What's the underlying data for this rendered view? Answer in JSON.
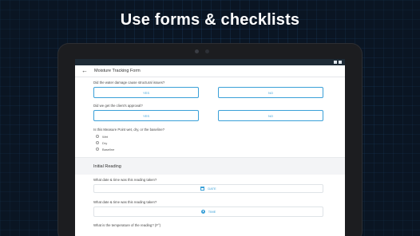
{
  "headline": "Use forms & checklists",
  "app": {
    "title": "Moisture Tracking Form"
  },
  "form": {
    "q1": {
      "text": "Did the water damage cause structural issues?",
      "yes": "YES",
      "no": "NO"
    },
    "q2": {
      "text": "Did we get the client's approval?",
      "yes": "YES",
      "no": "NO"
    },
    "q3": {
      "text": "Is this Measure Point wet, dry, or the baseline?",
      "options": [
        "Wet",
        "Dry",
        "Baseline"
      ]
    },
    "section_title": "Initial Reading",
    "q4": {
      "text": "What date & time was this reading taken?",
      "button": "DATE"
    },
    "q5": {
      "text": "What date & time was this reading taken?",
      "button": "TIME"
    },
    "q6": {
      "text": "What is the temperature of the reading? (F°)"
    }
  },
  "icons": {
    "back": "arrow-back-icon",
    "date": "calendar-icon",
    "time": "clock-icon"
  },
  "colors": {
    "accent": "#3aa0d8",
    "background": "#0a1523",
    "status_bar": "#1e2b36"
  }
}
